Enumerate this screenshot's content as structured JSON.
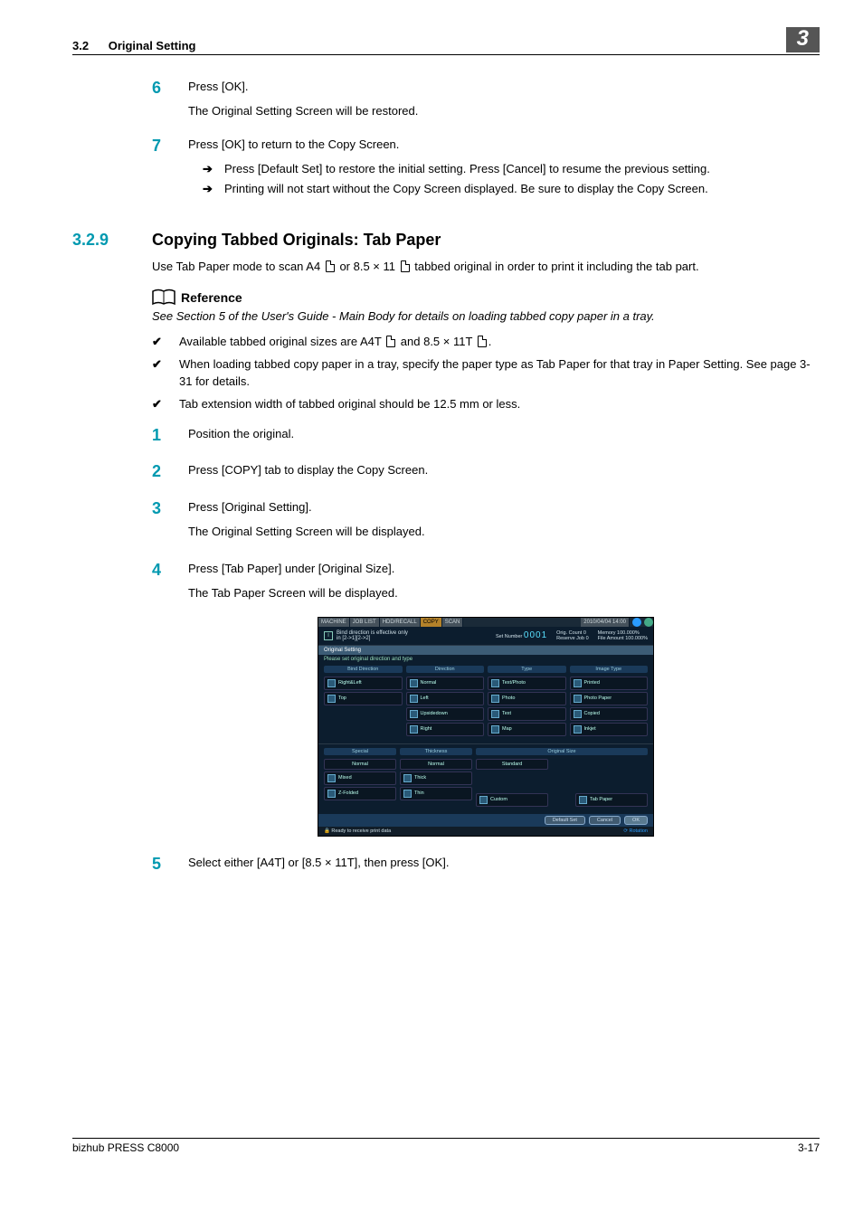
{
  "header": {
    "section_number": "3.2",
    "section_title": "Original Setting",
    "chapter_badge": "3"
  },
  "top_steps": {
    "s6": {
      "num": "6",
      "line1": "Press [OK].",
      "line2": "The Original Setting Screen will be restored."
    },
    "s7": {
      "num": "7",
      "line1": "Press [OK] to return to the Copy Screen.",
      "arrow1": "Press [Default Set] to restore the initial setting. Press [Cancel] to resume the previous setting.",
      "arrow2": "Printing will not start without the Copy Screen displayed. Be sure to display the Copy Screen."
    }
  },
  "subsection": {
    "number": "3.2.9",
    "title": "Copying Tabbed Originals: Tab Paper",
    "use_para_pre": "Use Tab Paper mode to scan A4 ",
    "use_para_mid": " or 8.5 × 11 ",
    "use_para_post": " tabbed original in order to print it including the tab part."
  },
  "reference": {
    "label": "Reference",
    "text": "See Section 5 of the User's Guide - Main Body for details on loading tabbed copy paper in a tray."
  },
  "checks": {
    "c1_pre": "Available tabbed original sizes are A4T ",
    "c1_mid": " and 8.5 × 11T ",
    "c1_post": ".",
    "c2": "When loading tabbed copy paper in a tray, specify the paper type as Tab Paper for that tray in Paper Setting. See page 3-31 for details.",
    "c3": "Tab extension width of tabbed original should be 12.5 mm or less."
  },
  "steps": {
    "s1": {
      "num": "1",
      "t": "Position the original."
    },
    "s2": {
      "num": "2",
      "t": "Press [COPY] tab to display the Copy Screen."
    },
    "s3": {
      "num": "3",
      "t1": "Press [Original Setting].",
      "t2": "The Original Setting Screen will be displayed."
    },
    "s4": {
      "num": "4",
      "t1": "Press [Tab Paper] under [Original Size].",
      "t2": "The Tab Paper Screen will be displayed."
    },
    "s5": {
      "num": "5",
      "t": "Select either [A4T] or [8.5 × 11T], then press [OK]."
    }
  },
  "screenshot": {
    "tabs": {
      "machine": "MACHINE",
      "joblist": "JOB LIST",
      "recall": "HDD/RECALL",
      "copy": "COPY",
      "scan": "SCAN"
    },
    "time": "2010/04/04 14:00",
    "msg_l1": "Bind direction is effective only",
    "msg_l2": "in [2->1][2->2]",
    "set_number_label": "Set Number",
    "set_number_value": "0001",
    "orig_count_label": "Orig. Count",
    "orig_count_value": "0",
    "reserve_job_label": "Reserve Job",
    "reserve_job_value": "0",
    "memory_label": "Memory",
    "memory_value": "100.000%",
    "file_label": "File Amount",
    "file_value": "100.000%",
    "screen_title": "Original Setting",
    "instruction": "Please set original direction and type",
    "cols": {
      "bind": "Bind Direction",
      "dir": "Direction",
      "type": "Type",
      "imgtype": "Image Type",
      "special": "Special",
      "thick": "Thickness",
      "origsize": "Original Size"
    },
    "bind_right_left": "Right&Left",
    "bind_top": "Top",
    "dir_normal": "Normal",
    "dir_left": "Left",
    "dir_upsidedown": "Upsidedown",
    "dir_right": "Right",
    "type_textphoto": "Text/Photo",
    "type_photo": "Photo",
    "type_text": "Text",
    "type_map": "Map",
    "img_printed": "Printed",
    "img_photopaper": "Photo Paper",
    "img_copied": "Copied",
    "img_inkjet": "Inkjet",
    "sp_normal": "Normal",
    "sp_mixed": "Mixed",
    "sp_zfold": "Z-Folded",
    "th_normal": "Normal",
    "th_thick": "Thick",
    "th_thin": "Thin",
    "size_standard": "Standard",
    "size_custom": "Custom",
    "size_tabpaper": "Tab Paper",
    "footer_default": "Default Set",
    "footer_cancel": "Cancel",
    "footer_ok": "OK",
    "status_ready": "Ready to receive print data",
    "rotation": "Rotation"
  },
  "footer": {
    "left": "bizhub PRESS C8000",
    "right": "3-17"
  }
}
